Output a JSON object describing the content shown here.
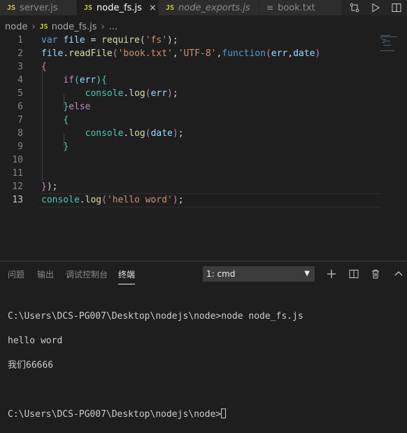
{
  "tabs": [
    {
      "type": "JS",
      "name": "server.js",
      "active": false,
      "italic": false
    },
    {
      "type": "JS",
      "name": "node_fs.js",
      "active": true,
      "italic": false,
      "close": "×"
    },
    {
      "type": "JS",
      "name": "node_exports.js",
      "active": false,
      "italic": true
    },
    {
      "type": "≡",
      "name": "book.txt",
      "active": false,
      "italic": false
    }
  ],
  "breadcrumb": {
    "folder": "node",
    "file_type": "JS",
    "file": "node_fs.js",
    "more": "..."
  },
  "editor": {
    "line_numbers": [
      "1",
      "2",
      "3",
      "4",
      "5",
      "6",
      "7",
      "8",
      "9",
      "10",
      "11",
      "12",
      "13"
    ]
  },
  "panel": {
    "tabs": [
      "问题",
      "输出",
      "调试控制台",
      "终端"
    ],
    "terminal_select": "1: cmd"
  },
  "terminal": {
    "lines": [
      "C:\\Users\\DCS-PG007\\Desktop\\nodejs\\node>node node_fs.js",
      "hello word",
      "我们66666",
      "",
      "C:\\Users\\DCS-PG007\\Desktop\\nodejs\\node>"
    ]
  }
}
